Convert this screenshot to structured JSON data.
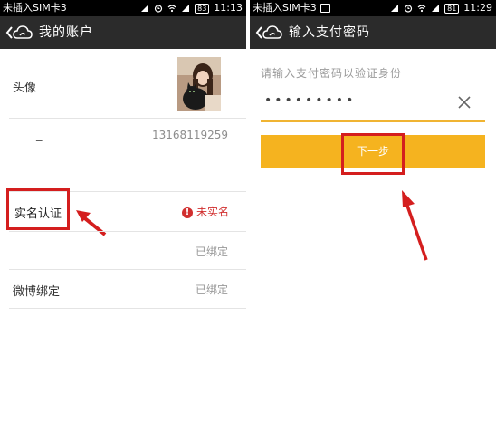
{
  "left": {
    "status": {
      "carrier": "未插入SIM卡3",
      "battery": "83",
      "time": "11:13"
    },
    "title": "我的账户",
    "rows": {
      "avatar_label": "头像",
      "phone_dash": "_",
      "phone_value": "13168119259",
      "realname_label": "实名认证",
      "realname_status": "未实名",
      "bound_value_1": "已绑定",
      "weibo_label": "微博绑定",
      "bound_value_2": "已绑定"
    }
  },
  "right": {
    "status": {
      "carrier": "未插入SIM卡3",
      "battery": "81",
      "time": "11:29"
    },
    "title": "输入支付密码",
    "prompt": "请输入支付密码以验证身份",
    "password_mask": "•••••••••",
    "next_label": "下一步"
  },
  "colors": {
    "accent": "#f5b31f",
    "highlight_red": "#d41e1e",
    "titlebar": "#2b2b2b",
    "warning": "#d12f2f"
  }
}
